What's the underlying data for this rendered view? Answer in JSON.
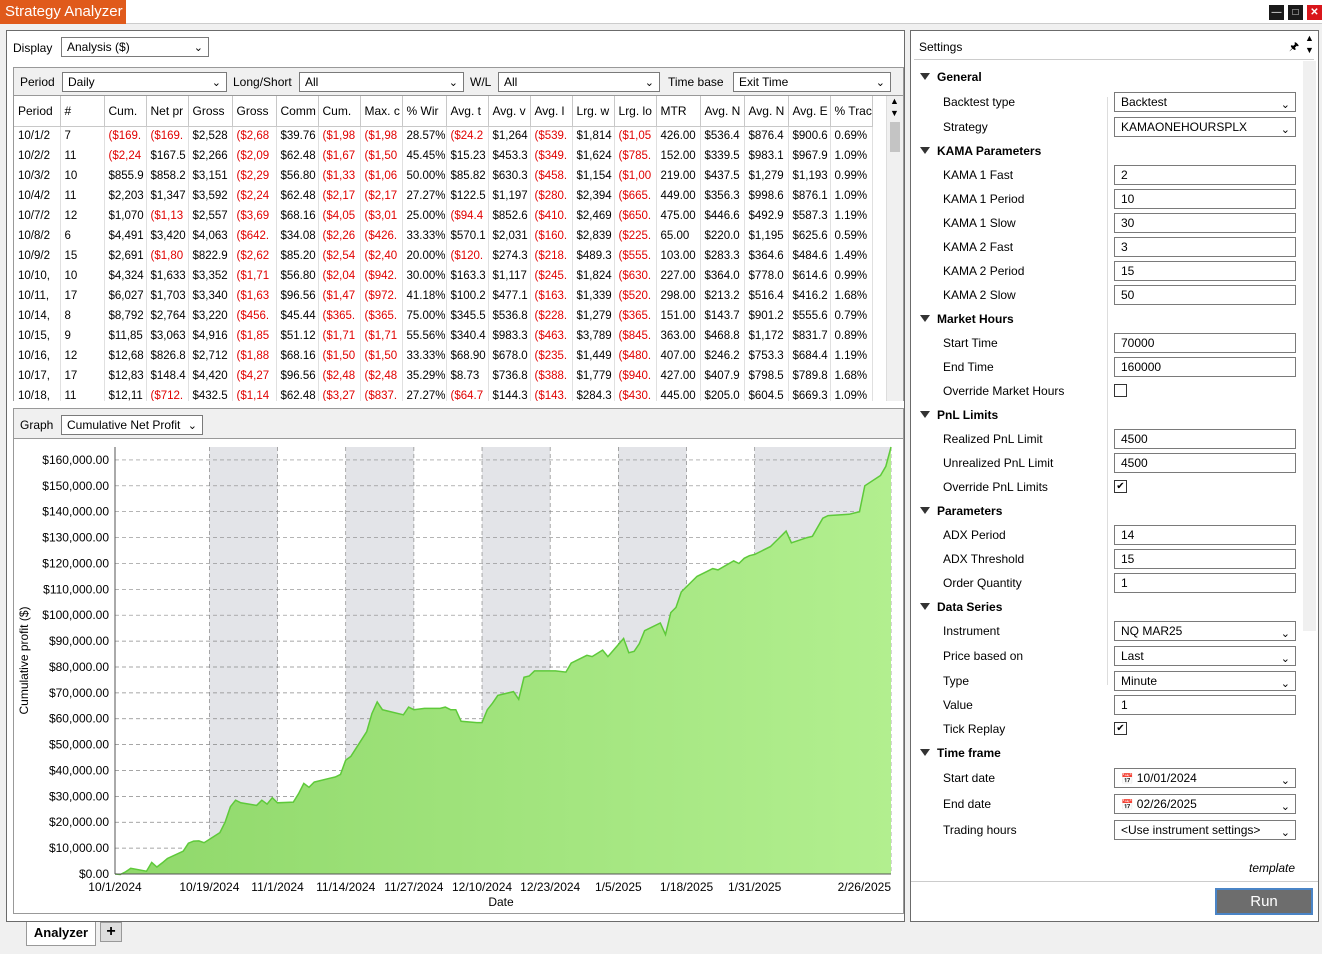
{
  "window": {
    "title": "Strategy Analyzer"
  },
  "display": {
    "label": "Display",
    "value": "Analysis ($)"
  },
  "filters": {
    "period_label": "Period",
    "period_value": "Daily",
    "longshort_label": "Long/Short",
    "longshort_value": "All",
    "wl_label": "W/L",
    "wl_value": "All",
    "timebase_label": "Time base",
    "timebase_value": "Exit Time"
  },
  "table": {
    "columns": [
      "Period",
      "#",
      "Cum.",
      "Net pr",
      "Gross",
      "Gross",
      "Comm",
      "Cum.",
      "Max. c",
      "% Wir",
      "Avg. t",
      "Avg. v",
      "Avg. l",
      "Lrg. w",
      "Lrg. lo",
      "MTR",
      "Avg. N",
      "Avg. N",
      "Avg. E",
      "% Trac"
    ],
    "rows": [
      [
        "10/1/2",
        "7",
        "($169.",
        "($169.",
        "$2,528",
        "($2,68",
        "$39.76",
        "($1,98",
        "($1,98",
        "28.57%",
        "($24.2",
        "$1,264",
        "($539.",
        "$1,814",
        "($1,05",
        "426.00",
        "$536.4",
        "$876.4",
        "$900.6",
        "0.69%"
      ],
      [
        "10/2/2",
        "11",
        "($2,24",
        "$167.5",
        "$2,266",
        "($2,09",
        "$62.48",
        "($1,67",
        "($1,50",
        "45.45%",
        "$15.23",
        "$453.3",
        "($349.",
        "$1,624",
        "($785.",
        "152.00",
        "$339.5",
        "$983.1",
        "$967.9",
        "1.09%"
      ],
      [
        "10/3/2",
        "10",
        "$855.9",
        "$858.2",
        "$3,151",
        "($2,29",
        "$56.80",
        "($1,33",
        "($1,06",
        "50.00%",
        "$85.82",
        "$630.3",
        "($458.",
        "$1,154",
        "($1,00",
        "219.00",
        "$437.5",
        "$1,279",
        "$1,193",
        "0.99%"
      ],
      [
        "10/4/2",
        "11",
        "$2,203",
        "$1,347",
        "$3,592",
        "($2,24",
        "$62.48",
        "($2,17",
        "($2,17",
        "27.27%",
        "$122.5",
        "$1,197",
        "($280.",
        "$2,394",
        "($665.",
        "449.00",
        "$356.3",
        "$998.6",
        "$876.1",
        "1.09%"
      ],
      [
        "10/7/2",
        "12",
        "$1,070",
        "($1,13",
        "$2,557",
        "($3,69",
        "$68.16",
        "($4,05",
        "($3,01",
        "25.00%",
        "($94.4",
        "$852.6",
        "($410.",
        "$2,469",
        "($650.",
        "475.00",
        "$446.6",
        "$492.9",
        "$587.3",
        "1.19%"
      ],
      [
        "10/8/2",
        "6",
        "$4,491",
        "$3,420",
        "$4,063",
        "($642.",
        "$34.08",
        "($2,26",
        "($426.",
        "33.33%",
        "$570.1",
        "$2,031",
        "($160.",
        "$2,839",
        "($225.",
        "65.00",
        "$220.0",
        "$1,195",
        "$625.6",
        "0.59%"
      ],
      [
        "10/9/2",
        "15",
        "$2,691",
        "($1,80",
        "$822.9",
        "($2,62",
        "$85.20",
        "($2,54",
        "($2,40",
        "20.00%",
        "($120.",
        "$274.3",
        "($218.",
        "$489.3",
        "($555.",
        "103.00",
        "$283.3",
        "$364.6",
        "$484.6",
        "1.49%"
      ],
      [
        "10/10,",
        "10",
        "$4,324",
        "$1,633",
        "$3,352",
        "($1,71",
        "$56.80",
        "($2,04",
        "($942.",
        "30.00%",
        "$163.3",
        "$1,117",
        "($245.",
        "$1,824",
        "($630.",
        "227.00",
        "$364.0",
        "$778.0",
        "$614.6",
        "0.99%"
      ],
      [
        "10/11,",
        "17",
        "$6,027",
        "$1,703",
        "$3,340",
        "($1,63",
        "$96.56",
        "($1,47",
        "($972.",
        "41.18%",
        "$100.2",
        "$477.1",
        "($163.",
        "$1,339",
        "($520.",
        "298.00",
        "$213.2",
        "$516.4",
        "$416.2",
        "1.68%"
      ],
      [
        "10/14,",
        "8",
        "$8,792",
        "$2,764",
        "$3,220",
        "($456.",
        "$45.44",
        "($365.",
        "($365.",
        "75.00%",
        "$345.5",
        "$536.8",
        "($228.",
        "$1,279",
        "($365.",
        "151.00",
        "$143.7",
        "$901.2",
        "$555.6",
        "0.79%"
      ],
      [
        "10/15,",
        "9",
        "$11,85",
        "$3,063",
        "$4,916",
        "($1,85",
        "$51.12",
        "($1,71",
        "($1,71",
        "55.56%",
        "$340.4",
        "$983.3",
        "($463.",
        "$3,789",
        "($845.",
        "363.00",
        "$468.8",
        "$1,172",
        "$831.7",
        "0.89%"
      ],
      [
        "10/16,",
        "12",
        "$12,68",
        "$826.8",
        "$2,712",
        "($1,88",
        "$68.16",
        "($1,50",
        "($1,50",
        "33.33%",
        "$68.90",
        "$678.0",
        "($235.",
        "$1,449",
        "($480.",
        "407.00",
        "$246.2",
        "$753.3",
        "$684.4",
        "1.19%"
      ],
      [
        "10/17,",
        "17",
        "$12,83",
        "$148.4",
        "$4,420",
        "($4,27",
        "$96.56",
        "($2,48",
        "($2,48",
        "35.29%",
        "$8.73",
        "$736.8",
        "($388.",
        "$1,779",
        "($940.",
        "427.00",
        "$407.9",
        "$798.5",
        "$789.8",
        "1.68%"
      ],
      [
        "10/18,",
        "11",
        "$12,11",
        "($712.",
        "$432.5",
        "($1,14",
        "$62.48",
        "($3,27",
        "($837.",
        "27.27%",
        "($64.7",
        "$144.3",
        "($143.",
        "$284.3",
        "($430.",
        "445.00",
        "$205.0",
        "$604.5",
        "$669.3",
        "1.09%"
      ]
    ]
  },
  "graph": {
    "label": "Graph",
    "value": "Cumulative Net Profit"
  },
  "chart_data": {
    "type": "area",
    "xlabel": "Date",
    "ylabel": "Cumulative profit ($)",
    "ylim": [
      0,
      165000
    ],
    "y_ticks": [
      "$0.00",
      "$10,000.00",
      "$20,000.00",
      "$30,000.00",
      "$40,000.00",
      "$50,000.00",
      "$60,000.00",
      "$70,000.00",
      "$80,000.00",
      "$90,000.00",
      "$100,000.00",
      "$110,000.00",
      "$120,000.00",
      "$130,000.00",
      "$140,000.00",
      "$150,000.00",
      "$160,000.00"
    ],
    "x_ticks": [
      "10/1/2024",
      "10/19/2024",
      "11/1/2024",
      "11/14/2024",
      "11/27/2024",
      "12/10/2024",
      "12/23/2024",
      "1/5/2025",
      "1/18/2025",
      "1/31/2025",
      "2/26/2025"
    ],
    "grid": true,
    "fill_color": "#a8e888",
    "line_color": "#5ec93a",
    "points": [
      [
        "10/1/2024",
        0
      ],
      [
        "10/2/2024",
        -200
      ],
      [
        "10/3/2024",
        800
      ],
      [
        "10/4/2024",
        2200
      ],
      [
        "10/7/2024",
        1100
      ],
      [
        "10/8/2024",
        4500
      ],
      [
        "10/9/2024",
        2700
      ],
      [
        "10/10/2024",
        4300
      ],
      [
        "10/11/2024",
        6000
      ],
      [
        "10/14/2024",
        8800
      ],
      [
        "10/15/2024",
        11900
      ],
      [
        "10/16/2024",
        12700
      ],
      [
        "10/17/2024",
        12800
      ],
      [
        "10/18/2024",
        12100
      ],
      [
        "10/21/2024",
        16000
      ],
      [
        "10/22/2024",
        20000
      ],
      [
        "10/23/2024",
        26000
      ],
      [
        "10/24/2024",
        28500
      ],
      [
        "10/25/2024",
        27500
      ],
      [
        "10/28/2024",
        26500
      ],
      [
        "10/29/2024",
        28500
      ],
      [
        "10/30/2024",
        27000
      ],
      [
        "10/31/2024",
        29500
      ],
      [
        "11/1/2024",
        27500
      ],
      [
        "11/4/2024",
        27800
      ],
      [
        "11/5/2024",
        31000
      ],
      [
        "11/6/2024",
        35000
      ],
      [
        "11/7/2024",
        33500
      ],
      [
        "11/8/2024",
        35500
      ],
      [
        "11/11/2024",
        37000
      ],
      [
        "11/12/2024",
        37500
      ],
      [
        "11/13/2024",
        38500
      ],
      [
        "11/14/2024",
        44000
      ],
      [
        "11/15/2024",
        45500
      ],
      [
        "11/18/2024",
        55000
      ],
      [
        "11/19/2024",
        62000
      ],
      [
        "11/20/2024",
        66500
      ],
      [
        "11/21/2024",
        63500
      ],
      [
        "11/22/2024",
        63000
      ],
      [
        "11/25/2024",
        61500
      ],
      [
        "11/26/2024",
        64500
      ],
      [
        "11/27/2024",
        63500
      ],
      [
        "11/29/2024",
        64000
      ],
      [
        "12/2/2024",
        64000
      ],
      [
        "12/3/2024",
        64500
      ],
      [
        "12/4/2024",
        63500
      ],
      [
        "12/5/2024",
        63500
      ],
      [
        "12/6/2024",
        59000
      ],
      [
        "12/9/2024",
        58500
      ],
      [
        "12/10/2024",
        58500
      ],
      [
        "12/11/2024",
        63500
      ],
      [
        "12/12/2024",
        66000
      ],
      [
        "12/13/2024",
        69000
      ],
      [
        "12/16/2024",
        70500
      ],
      [
        "12/17/2024",
        67500
      ],
      [
        "12/18/2024",
        76000
      ],
      [
        "12/19/2024",
        76500
      ],
      [
        "12/20/2024",
        78500
      ],
      [
        "12/23/2024",
        78500
      ],
      [
        "12/24/2024",
        78500
      ],
      [
        "12/26/2024",
        78000
      ],
      [
        "12/27/2024",
        81500
      ],
      [
        "12/30/2024",
        84500
      ],
      [
        "12/31/2024",
        84000
      ],
      [
        "1/2/2025",
        86500
      ],
      [
        "1/3/2025",
        84000
      ],
      [
        "1/6/2025",
        91000
      ],
      [
        "1/7/2025",
        85500
      ],
      [
        "1/8/2025",
        86000
      ],
      [
        "1/9/2025",
        89000
      ],
      [
        "1/10/2025",
        94000
      ],
      [
        "1/13/2025",
        97000
      ],
      [
        "1/14/2025",
        92500
      ],
      [
        "1/15/2025",
        101000
      ],
      [
        "1/16/2025",
        103000
      ],
      [
        "1/17/2025",
        109000
      ],
      [
        "1/20/2025",
        115000
      ],
      [
        "1/21/2025",
        116000
      ],
      [
        "1/22/2025",
        117000
      ],
      [
        "1/23/2025",
        118000
      ],
      [
        "1/24/2025",
        117500
      ],
      [
        "1/27/2025",
        121000
      ],
      [
        "1/28/2025",
        120000
      ],
      [
        "1/29/2025",
        122000
      ],
      [
        "1/30/2025",
        123000
      ],
      [
        "1/31/2025",
        123500
      ],
      [
        "2/3/2025",
        126500
      ],
      [
        "2/4/2025",
        128500
      ],
      [
        "2/5/2025",
        130500
      ],
      [
        "2/6/2025",
        132500
      ],
      [
        "2/7/2025",
        128000
      ],
      [
        "2/10/2025",
        130000
      ],
      [
        "2/11/2025",
        130500
      ],
      [
        "2/12/2025",
        134000
      ],
      [
        "2/13/2025",
        137500
      ],
      [
        "2/14/2025",
        138500
      ],
      [
        "2/18/2025",
        139000
      ],
      [
        "2/19/2025",
        139500
      ],
      [
        "2/20/2025",
        140000
      ],
      [
        "2/21/2025",
        150000
      ],
      [
        "2/24/2025",
        154000
      ],
      [
        "2/25/2025",
        157500
      ],
      [
        "2/26/2025",
        165000
      ]
    ]
  },
  "settings": {
    "title": "Settings",
    "categories": {
      "general": "General",
      "kama": "KAMA Parameters",
      "market": "Market Hours",
      "pnl": "PnL Limits",
      "params": "Parameters",
      "series": "Data Series",
      "timeframe": "Time frame"
    },
    "backtest_type": {
      "label": "Backtest type",
      "value": "Backtest"
    },
    "strategy": {
      "label": "Strategy",
      "value": "KAMAONEHOURSPLX"
    },
    "kama1_fast": {
      "label": "KAMA 1 Fast",
      "value": "2"
    },
    "kama1_period": {
      "label": "KAMA 1 Period",
      "value": "10"
    },
    "kama1_slow": {
      "label": "KAMA 1 Slow",
      "value": "30"
    },
    "kama2_fast": {
      "label": "KAMA 2 Fast",
      "value": "3"
    },
    "kama2_period": {
      "label": "KAMA 2 Period",
      "value": "15"
    },
    "kama2_slow": {
      "label": "KAMA 2 Slow",
      "value": "50"
    },
    "start_time": {
      "label": "Start Time",
      "value": "70000"
    },
    "end_time": {
      "label": "End Time",
      "value": "160000"
    },
    "override_market": {
      "label": "Override Market Hours",
      "checked": false
    },
    "realized_pnl": {
      "label": "Realized PnL Limit",
      "value": "4500"
    },
    "unrealized_pnl": {
      "label": "Unrealized PnL Limit",
      "value": "4500"
    },
    "override_pnl": {
      "label": "Override PnL Limits",
      "checked": true
    },
    "adx_period": {
      "label": "ADX Period",
      "value": "14"
    },
    "adx_threshold": {
      "label": "ADX Threshold",
      "value": "15"
    },
    "order_qty": {
      "label": "Order Quantity",
      "value": "1"
    },
    "instrument": {
      "label": "Instrument",
      "value": "NQ MAR25"
    },
    "price_based": {
      "label": "Price based on",
      "value": "Last"
    },
    "type": {
      "label": "Type",
      "value": "Minute"
    },
    "value": {
      "label": "Value",
      "value": "1"
    },
    "tick_replay": {
      "label": "Tick Replay",
      "checked": true
    },
    "start_date": {
      "label": "Start date",
      "value": "10/01/2024"
    },
    "end_date": {
      "label": "End date",
      "value": "02/26/2025"
    },
    "trading_hours": {
      "label": "Trading hours",
      "value": "<Use instrument settings>"
    },
    "template_link": "template",
    "run_label": "Run"
  },
  "tabs": {
    "analyzer": "Analyzer",
    "add": "+"
  }
}
